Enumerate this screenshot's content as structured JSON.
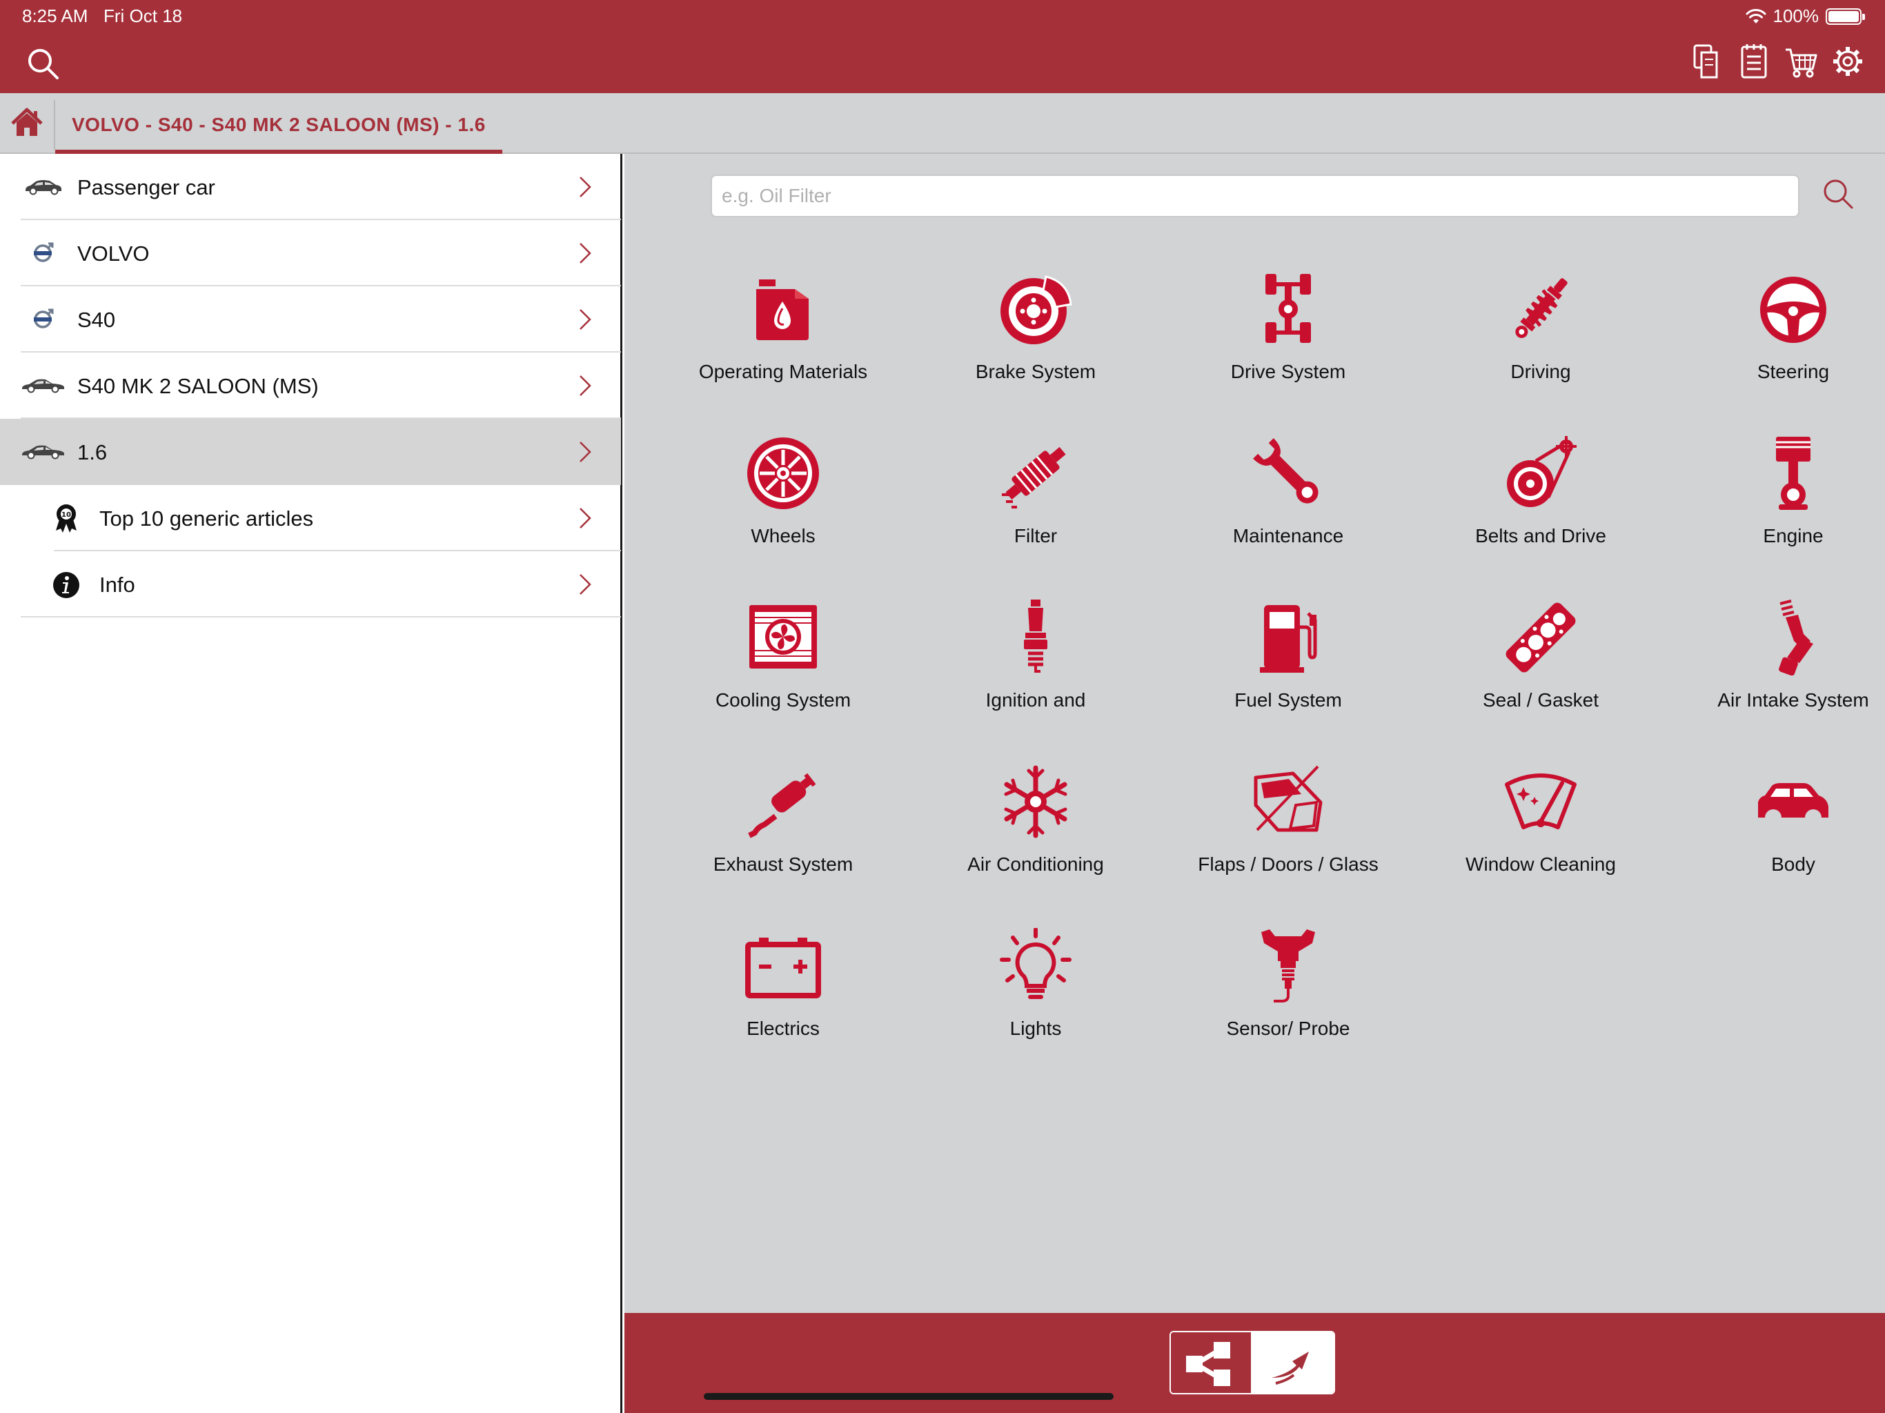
{
  "status": {
    "time": "8:25 AM",
    "date": "Fri Oct 18",
    "battery": "100%",
    "battery_level": 1.0
  },
  "breadcrumb": {
    "path": "VOLVO - S40 - S40 MK 2 SALOON (MS) - 1.6"
  },
  "sidebar": {
    "items": [
      {
        "label": "Passenger car",
        "icon": "car-icon"
      },
      {
        "label": "VOLVO",
        "icon": "volvo-logo-icon"
      },
      {
        "label": "S40",
        "icon": "volvo-logo-icon"
      },
      {
        "label": "S40 MK 2 SALOON (MS)",
        "icon": "sedan-icon"
      },
      {
        "label": "1.6",
        "icon": "sedan-icon",
        "selected": true
      },
      {
        "label": "Top 10 generic articles",
        "icon": "award-icon"
      },
      {
        "label": "Info",
        "icon": "info-icon"
      }
    ]
  },
  "search": {
    "placeholder": "e.g. Oil Filter",
    "value": ""
  },
  "categories": [
    {
      "label": "Operating Materials",
      "icon": "oil-can-icon"
    },
    {
      "label": "Brake System",
      "icon": "brake-disc-icon"
    },
    {
      "label": "Drive System",
      "icon": "drivetrain-icon"
    },
    {
      "label": "Driving",
      "icon": "shock-absorber-icon"
    },
    {
      "label": "Steering",
      "icon": "steering-wheel-icon"
    },
    {
      "label": "Wheels",
      "icon": "wheel-icon"
    },
    {
      "label": "Filter",
      "icon": "filter-icon"
    },
    {
      "label": "Maintenance",
      "icon": "wrench-icon"
    },
    {
      "label": "Belts and Drive",
      "icon": "belt-drive-icon"
    },
    {
      "label": "Engine",
      "icon": "piston-icon"
    },
    {
      "label": "Cooling System",
      "icon": "radiator-icon"
    },
    {
      "label": "Ignition and",
      "icon": "spark-plug-icon"
    },
    {
      "label": "Fuel System",
      "icon": "fuel-pump-icon"
    },
    {
      "label": "Seal / Gasket",
      "icon": "gasket-icon"
    },
    {
      "label": "Air Intake System",
      "icon": "air-intake-icon"
    },
    {
      "label": "Exhaust System",
      "icon": "exhaust-icon"
    },
    {
      "label": "Air Conditioning",
      "icon": "snowflake-icon"
    },
    {
      "label": "Flaps / Doors / Glass",
      "icon": "car-door-icon"
    },
    {
      "label": "Window Cleaning",
      "icon": "wiper-icon"
    },
    {
      "label": "Body",
      "icon": "car-body-icon"
    },
    {
      "label": "Electrics",
      "icon": "battery-icon"
    },
    {
      "label": "Lights",
      "icon": "light-bulb-icon"
    },
    {
      "label": "Sensor/ Probe",
      "icon": "sensor-icon"
    }
  ],
  "colors": {
    "brand": "#a5303a",
    "panel": "#d1d3d5",
    "selected": "#d5d5d5"
  }
}
